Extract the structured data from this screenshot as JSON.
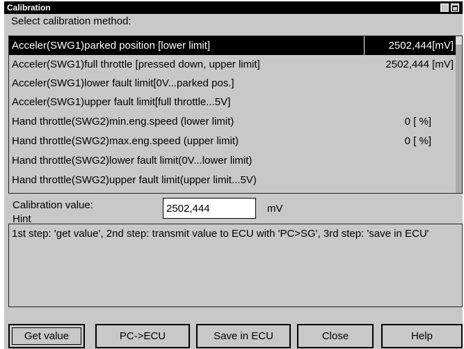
{
  "window": {
    "title": "Calibration"
  },
  "section_label": "Select calibration method:",
  "methods": [
    {
      "label": "Acceler(SWG1)parked position [lower limit]",
      "value": "2502,444[mV]",
      "selected": true
    },
    {
      "label": "Acceler(SWG1)full throttle [pressed down, upper limit]",
      "value": "2502,444 [mV]",
      "selected": false
    },
    {
      "label": "Acceler(SWG1)lower fault limit[0V...parked pos.]",
      "value": "",
      "selected": false
    },
    {
      "label": "Acceler(SWG1)upper fault limit[full throttle...5V]",
      "value": "",
      "selected": false
    },
    {
      "label": "Hand throttle(SWG2)min.eng.speed (lower limit)",
      "value": "0 [ %]",
      "selected": false
    },
    {
      "label": "Hand throttle(SWG2)max.eng.speed (upper limit)",
      "value": "0 [ %]",
      "selected": false
    },
    {
      "label": "Hand throttle(SWG2)lower fault limit(0V...lower limit)",
      "value": "",
      "selected": false
    },
    {
      "label": "Hand throttle(SWG2)upper fault limit(upper limit...5V)",
      "value": "",
      "selected": false
    }
  ],
  "calibration": {
    "label": "Calibration value:",
    "value": "2502,444",
    "unit": "mV"
  },
  "hint": {
    "label": "Hint",
    "text": "1st step: 'get value', 2nd step: transmit value to ECU with 'PC>SG', 3rd step: 'save in ECU'"
  },
  "buttons": {
    "get_value": "Get value",
    "pc_ecu": "PC->ECU",
    "save_ecu": "Save in ECU",
    "close": "Close",
    "help": "Help"
  }
}
